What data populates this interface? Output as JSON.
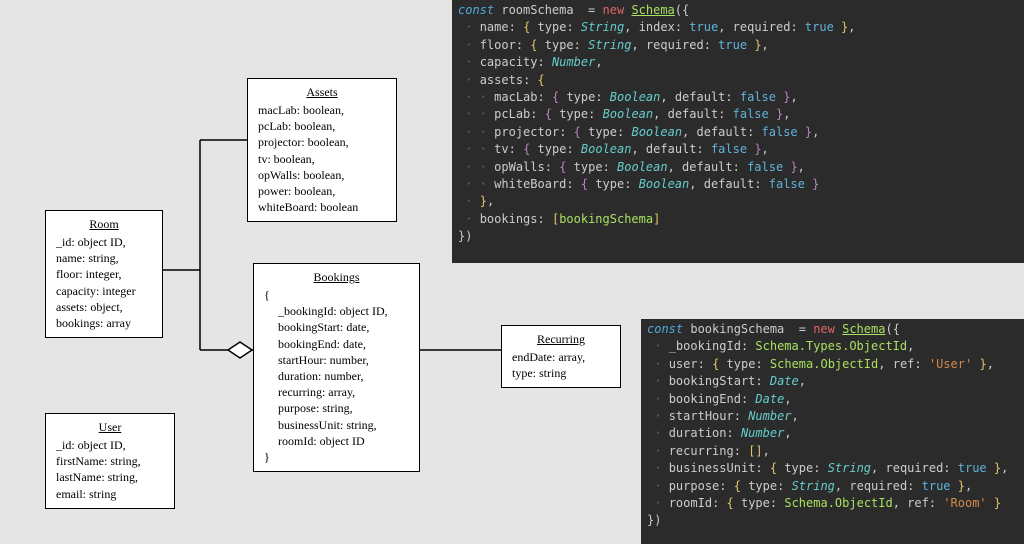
{
  "room": {
    "title": "Room",
    "f1": "_id: object ID,",
    "f2": "name: string,",
    "f3": "floor: integer,",
    "f4": "capacity: integer",
    "f5": "assets: object,",
    "f6": "bookings: array"
  },
  "assets": {
    "title": "Assets",
    "f1": "macLab: boolean,",
    "f2": "pcLab: boolean,",
    "f3": "projector: boolean,",
    "f4": "tv: boolean,",
    "f5": "opWalls: boolean,",
    "f6": "power: boolean,",
    "f7": "whiteBoard: boolean"
  },
  "bookings": {
    "title": "Bookings",
    "open": "{",
    "f1": "_bookingId: object ID,",
    "f2": "bookingStart: date,",
    "f3": "bookingEnd: date,",
    "f4": "startHour: number,",
    "f5": "duration: number,",
    "f6": "recurring: array,",
    "f7": "purpose: string,",
    "f8": "businessUnit: string,",
    "f9": "roomId: object ID",
    "close": "}"
  },
  "recurring": {
    "title": "Recurring",
    "f1": "endDate: array,",
    "f2": "type: string"
  },
  "user": {
    "title": "User",
    "f1": "_id: object ID,",
    "f2": "firstName: string,",
    "f3": "lastName: string,",
    "f4": "email: string"
  },
  "code": {
    "const": "const",
    "new": "new",
    "Schema": "Schema",
    "roomVar": " roomSchema ",
    "bookVar": " bookingSchema ",
    "eq": " = ",
    "open": "({",
    "name": "name",
    "floor": "floor",
    "capacity": "capacity",
    "assetsKey": "assets",
    "macLab": "macLab",
    "pcLab": "pcLab",
    "projector": "projector",
    "tv": "tv",
    "opWalls": "opWalls",
    "whiteBoard": "whiteBoard",
    "bookings": "bookings",
    "bookingSchema": "bookingSchema",
    "type": "type",
    "index": "index",
    "required": "required",
    "default": "default",
    "ref": "ref",
    "String": "String",
    "Number": "Number",
    "Boolean": "Boolean",
    "Date": "Date",
    "true": "true",
    "false": "false",
    "close": "})",
    "bId": "_bookingId",
    "user": "user",
    "bStart": "bookingStart",
    "bEnd": "bookingEnd",
    "sHour": "startHour",
    "dur": "duration",
    "rec": "recurring",
    "bu": "businessUnit",
    "purp": "purpose",
    "rId": "roomId",
    "ObjectId": "Schema.Types.ObjectId",
    "ObjectId2": "Schema.ObjectId",
    "UserStr": "'User'",
    "RoomStr": "'Room'",
    "empty": "[]"
  }
}
